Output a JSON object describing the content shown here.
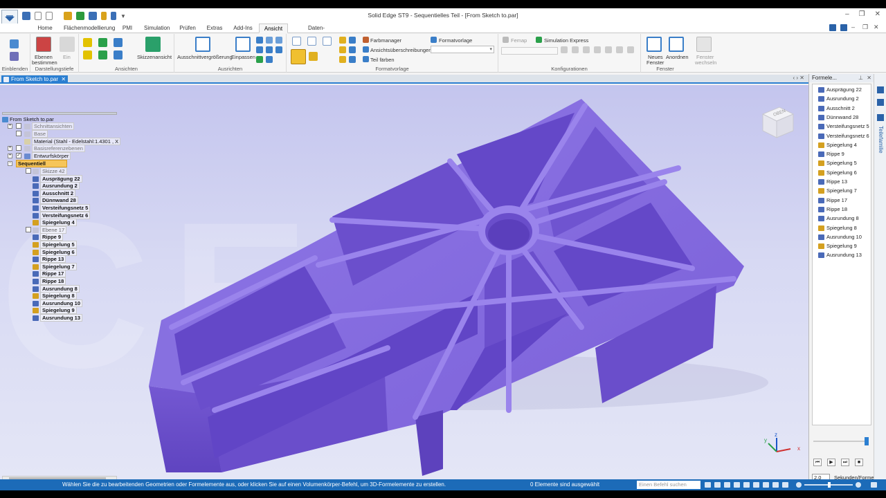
{
  "window": {
    "title": "Solid Edge ST9 - Sequentielles Teil - [From Sketch to.par]"
  },
  "tabs": [
    "Home",
    "Flächenmodellierung",
    "PMI",
    "Simulation",
    "Prüfen",
    "Extras",
    "Add-Ins",
    "Ansicht",
    "Daten-Management"
  ],
  "active_tab": "Ansicht",
  "ribbon": {
    "groups": {
      "einblenden": "Einblenden",
      "darstellungstiefe": "Darstellungstiefe",
      "ansichten": "Ansichten",
      "ausrichten": "Ausrichten",
      "formatvorlage": "Formatvorlage",
      "konfigurationen": "Konfigurationen",
      "fenster": "Fenster"
    },
    "ebenen_line1": "Ebenen",
    "ebenen_line2": "bestimmen",
    "ein_line1": "Ein",
    "ein_line2": "",
    "skizzenansicht": "Skizzenansicht",
    "ausschnitt": "Ausschnittvergrößerung",
    "einpassen": "Einpassen",
    "farbmanager": "Farbmanager",
    "formatvorlage": "Formatvorlage",
    "ansichtsueber": "Ansichtsüberschreibungen",
    "teil_faerben": "Teil färben",
    "femap": "Femap",
    "simulation_express": "Simulation Express",
    "neues_line1": "Neues",
    "neues_line2": "Fenster",
    "anordnen": "Anordnen",
    "fenster_wechseln_line1": "Fenster",
    "fenster_wechseln_line2": "wechseln"
  },
  "document_tab": "From Sketch to.par",
  "pathfinder": {
    "root": "From Sketch to.par",
    "schnittansichten": "Schnittansichten",
    "base": "Base",
    "material": "Material (Stahl - Edelstahl:1.4301 , X",
    "basisreferenzebenen": "Basisreferenzebenen",
    "entwurfskoerper": "Entwurfskörper",
    "sequentiell": "Sequentiell",
    "features": [
      "Skizze 42",
      "Ausprägung 22",
      "Ausrundung 2",
      "Ausschnitt 2",
      "Dünnwand 28",
      "Versteifungsnetz 5",
      "Versteifungsnetz 6",
      "Spiegelung 4",
      "Ebene 17",
      "Rippe 9",
      "Spiegelung 5",
      "Spiegelung 6",
      "Rippe 13",
      "Spiegelung 7",
      "Rippe 17",
      "Rippe 18",
      "Ausrundung 8",
      "Spiegelung 8",
      "Ausrundung 10",
      "Spiegelung 9",
      "Ausrundung 13"
    ]
  },
  "view_cube": {
    "label": "OBEN"
  },
  "right_panel": {
    "title": "Formele...",
    "items": [
      "Ausprägung 22",
      "Ausrundung 2",
      "Ausschnitt 2",
      "Dünnwand 28",
      "Versteifungsnetz 5",
      "Versteifungsnetz 6",
      "Spiegelung 4",
      "Rippe 9",
      "Spiegelung 5",
      "Spiegelung 6",
      "Rippe 13",
      "Spiegelung 7",
      "Rippe 17",
      "Rippe 18",
      "Ausrundung 8",
      "Spiegelung 8",
      "Ausrundung 10",
      "Spiegelung 9",
      "Ausrundung 13"
    ],
    "seconds_value": "2.0",
    "seconds_label": "Sekunden/Forme",
    "side_label": "Teilefamilie"
  },
  "status": {
    "message": "Wählen Sie die zu bearbeitenden Geometrien oder Formelemente aus, oder klicken Sie auf einen Volumenkörper-Befehl, um 3D-Formelemente zu erstellen.",
    "selection": "0 Elemente sind ausgewählt",
    "search_placeholder": "Einen Befehl suchen"
  },
  "colors": {
    "accent": "#2b7fd1",
    "part": "#7b61d6",
    "status_bar": "#1c6bb8",
    "highlight": "#f6c55a"
  }
}
